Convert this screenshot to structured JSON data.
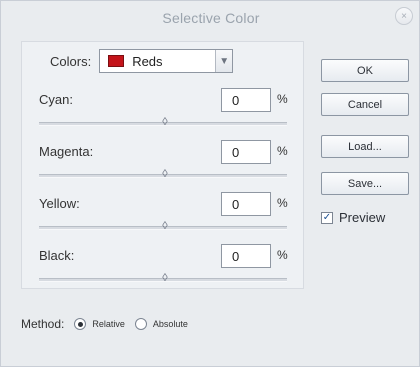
{
  "window": {
    "title": "Selective Color"
  },
  "colors": {
    "label": "Colors:",
    "selected": "Reds",
    "swatch_color": "#c4141a"
  },
  "fields": [
    {
      "label": "Cyan:",
      "value": "0",
      "unit": "%"
    },
    {
      "label": "Magenta:",
      "value": "0",
      "unit": "%"
    },
    {
      "label": "Yellow:",
      "value": "0",
      "unit": "%"
    },
    {
      "label": "Black:",
      "value": "0",
      "unit": "%"
    }
  ],
  "buttons": {
    "ok": "OK",
    "cancel": "Cancel",
    "load": "Load...",
    "save": "Save..."
  },
  "preview": {
    "label": "Preview",
    "checked": true
  },
  "method": {
    "label": "Method:",
    "options": [
      {
        "label": "Relative",
        "selected": true
      },
      {
        "label": "Absolute",
        "selected": false
      }
    ]
  }
}
